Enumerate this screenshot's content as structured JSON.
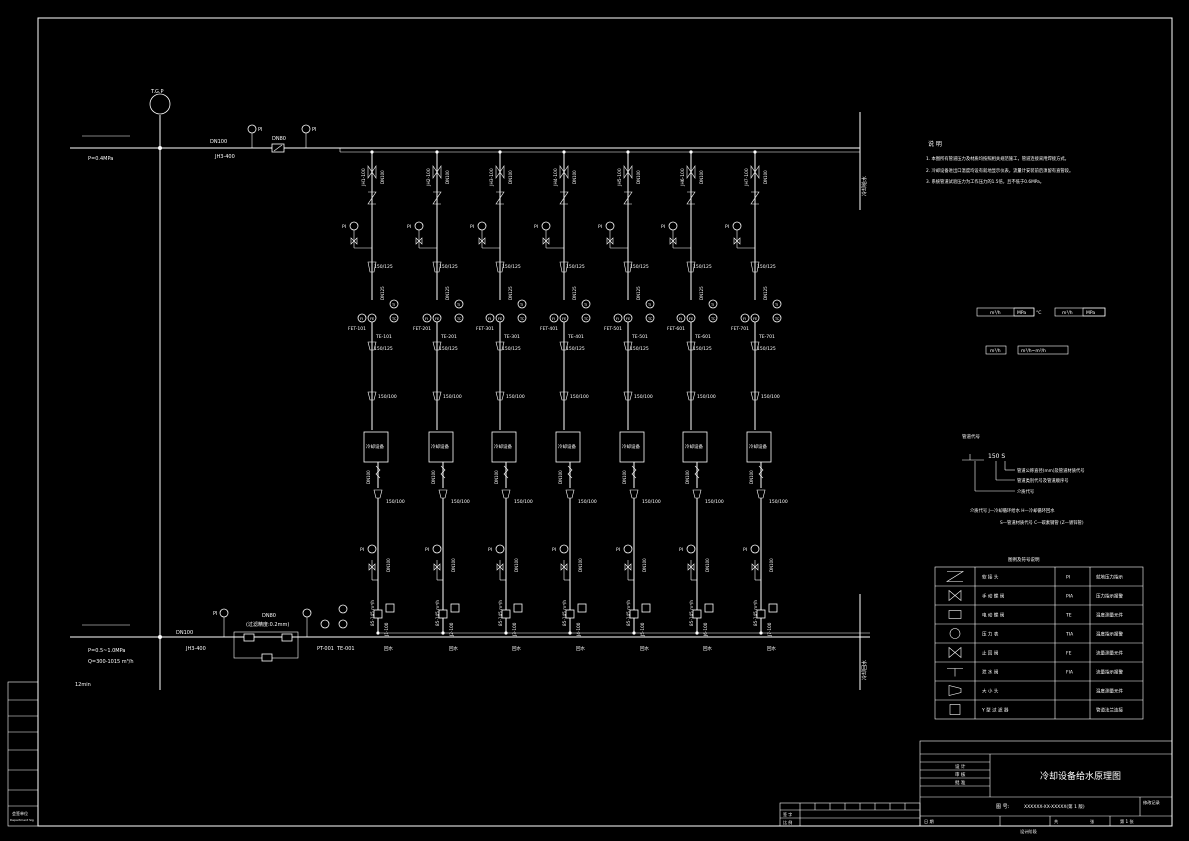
{
  "colors": {
    "background": "#000000",
    "line": "#ffffff"
  },
  "top_main": {
    "node": "T.G.P",
    "pressure": "P=0.4MPa",
    "size": "DN100",
    "tag": "JH3-400",
    "valve_size": "DN80",
    "gauge_a": "PI",
    "gauge_b": "PI"
  },
  "bottom_main": {
    "pressure": "P=0.5~1.0MPa",
    "flow": "Q=300-1015 m³/h",
    "time": "12min",
    "size": "DN100",
    "tag": "JH3-400",
    "valve_size": "DN80",
    "valve_note": "(过滤精度:0.2mm)",
    "pt": "PT-001",
    "tc": "TE-001",
    "gauge": "PI"
  },
  "branches": [
    {
      "tag": "JH1-100",
      "fet": "FET-101",
      "tc": "TE-101",
      "flow": "85-145 m³/h",
      "jtag": "J1-100"
    },
    {
      "tag": "JH2-100",
      "fet": "FET-201",
      "tc": "TE-201",
      "flow": "85-145 m³/h",
      "jtag": "J2-100"
    },
    {
      "tag": "JH3-100",
      "fet": "FET-301",
      "tc": "TE-301",
      "flow": "85-145 m³/h",
      "jtag": "J3-100"
    },
    {
      "tag": "JH4-100",
      "fet": "FET-401",
      "tc": "TE-401",
      "flow": "85-145 m³/h",
      "jtag": "J4-100"
    },
    {
      "tag": "JH5-100",
      "fet": "FET-501",
      "tc": "TE-501",
      "flow": "85-145 m³/h",
      "jtag": "J5-100"
    },
    {
      "tag": "JH6-100",
      "fet": "FET-601",
      "tc": "TE-601",
      "flow": "85-145 m³/h",
      "jtag": "J6-100"
    },
    {
      "tag": "JH7-100",
      "fet": "FET-701",
      "tc": "TE-701",
      "flow": "85-145 m³/h",
      "jtag": "J7-100"
    }
  ],
  "branch_common": {
    "reducer_a": "150/125",
    "reducer_b": "150/125",
    "reducer_c": "150/100",
    "reducer_d": "150/100",
    "size_a": "DN100",
    "size_b": "DN125",
    "size_c": "DN100",
    "size_d": "DN100",
    "pi": "PI",
    "fi": "FI",
    "fe": "FE",
    "ti": "TI",
    "tc": "TC",
    "equipment": "冷却设备",
    "bottom_label": "回水"
  },
  "notes": {
    "title": "说 明",
    "lines": [
      "1. 本图所有管道压力及材质均按照相关规范施工，管道连接采用焊接方式。",
      "2. 冷却设备进出口温度均设有就地显示仪表，流量计安装前后须留有直管段。",
      "3. 系统管道试验压力为工作压力的1.5倍，且不低于0.6MPa。"
    ]
  },
  "mid_legend": {
    "row1": [
      "m³/h",
      "MPa",
      "°C",
      "m³/h",
      "MPa"
    ],
    "row2": [
      "m³/h",
      "m³/h~m³/h"
    ]
  },
  "tag_legend": {
    "title": "管道代号",
    "code": "150 S",
    "line1": "管道公称直径(mm)及管道材质代号",
    "line2": "管道类别代号及管道顺序号",
    "line3": "介质代号",
    "note_a": "介质代号  J—冷却循环给水  H—冷却循环回水",
    "note_b": "S—管道材质代号  C—碳素钢管  (Z—镀锌管)"
  },
  "symbol_legend": {
    "title": "图例及符号说明",
    "rows": [
      {
        "icon": "zigzag",
        "left": "软 接 头",
        "code": "PI",
        "right": "就地压力指示"
      },
      {
        "icon": "gate-valve",
        "left": "手 动 蝶 阀",
        "code": "PIA",
        "right": "压力指示报警"
      },
      {
        "icon": "box-valve",
        "left": "电 动 蝶 阀",
        "code": "TE",
        "right": "温度测量元件"
      },
      {
        "icon": "gauge",
        "left": "压 力 表",
        "code": "TIA",
        "right": "温度指示报警"
      },
      {
        "icon": "check-valve",
        "left": "止 回 阀",
        "code": "FE",
        "right": "流量测量元件"
      },
      {
        "icon": "funnel",
        "left": "泄 水 阀",
        "code": "FIA",
        "right": "流量指示报警"
      },
      {
        "icon": "reducer",
        "left": "大 小 头",
        "code": "",
        "right": "温度测量元件"
      },
      {
        "icon": "strainer",
        "left": "Y 型 过 滤 器",
        "code": "",
        "right": "管道法兰连接"
      }
    ]
  },
  "title_block": {
    "drawing_title": "冷却设备给水原理图",
    "no_label": "图  号:",
    "no_value": "XXXXXX-XX-XXXXX(第 1 版)",
    "scale_label": "比 例",
    "scale_value": "",
    "sheet_label": "共",
    "sheet_of": "张",
    "page": "第 1 张",
    "date_label": "日 期",
    "left_rows": [
      "设 计",
      "审 核",
      "批 准"
    ],
    "sig": "签 字",
    "design": "设计阶段",
    "stamp": "修改记录"
  },
  "left_stamp": {
    "line1": "会签单位",
    "line2": "Department Sig"
  },
  "right_side": {
    "top": "冷却给水",
    "bottom": "冷却回水"
  }
}
